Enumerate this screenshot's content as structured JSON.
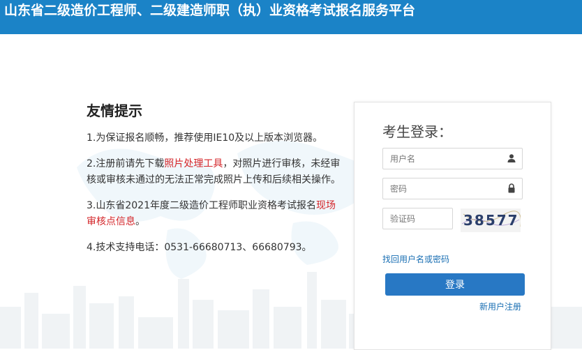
{
  "header": {
    "title": "山东省二级造价工程师、二级建造师职（执）业资格考试报名服务平台"
  },
  "tips": {
    "title": "友情提示",
    "items": [
      {
        "text": "1.为保证报名顺畅，推荐使用IE10及以上版本浏览器。"
      },
      {
        "pre": "2.注册前请先下载",
        "highlight": "照片处理工具",
        "post": "，对照片进行审核，未经审核或审核未通过的无法正常完成照片上传和后续相关操作。"
      },
      {
        "pre": "3.山东省2021年度二级造价工程师职业资格考试报名",
        "highlight": "现场审核点信息",
        "post": "。"
      },
      {
        "text": "4.技术支持电话：0531-66680713、66680793。"
      }
    ]
  },
  "login": {
    "title": "考生登录：",
    "username_placeholder": "用户名",
    "password_placeholder": "密码",
    "captcha_placeholder": "验证码",
    "captcha_text": "38577",
    "forgot_link": "找回用户名或密码",
    "login_button": "登录",
    "register_link": "新用户注册",
    "icons": {
      "username": "user-icon",
      "password": "lock-icon"
    }
  },
  "colors": {
    "header_bg": "#1b83c7",
    "highlight": "#d4262a",
    "button": "#2878c4",
    "link": "#1a6fb3"
  }
}
